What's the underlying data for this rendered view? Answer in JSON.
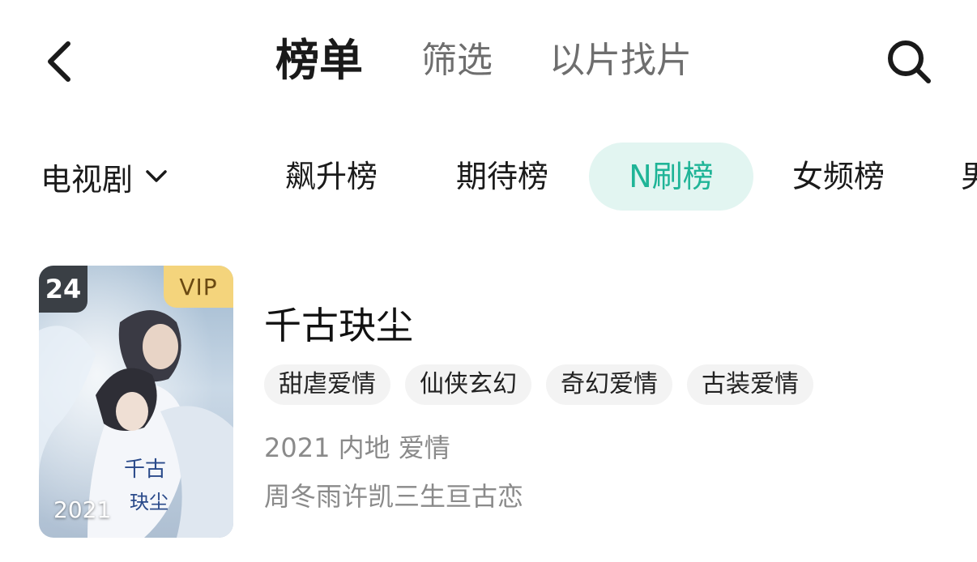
{
  "header": {
    "tabs": [
      {
        "label": "榜单",
        "active": true
      },
      {
        "label": "筛选",
        "active": false
      },
      {
        "label": "以片找片",
        "active": false
      }
    ],
    "icons": {
      "back": "chevron-left-icon",
      "search": "search-icon"
    }
  },
  "filters": {
    "category": "电视剧",
    "category_icon": "chevron-down-icon",
    "rank_tabs": [
      {
        "label": "飙升榜",
        "active": false
      },
      {
        "label": "期待榜",
        "active": false
      },
      {
        "label": "N刷榜",
        "active": true
      },
      {
        "label": "女频榜",
        "active": false
      },
      {
        "label": "男",
        "active": false
      }
    ],
    "active_color": "#1fb497",
    "active_bg": "#e2f5f1"
  },
  "item": {
    "rank": "24",
    "vip": "VIP",
    "poster_year": "2021",
    "title": "千古玦尘",
    "tags": [
      "甜虐爱情",
      "仙侠玄幻",
      "奇幻爱情",
      "古装爱情"
    ],
    "meta": "2021 内地 爱情",
    "desc": "周冬雨许凯三生亘古恋"
  }
}
